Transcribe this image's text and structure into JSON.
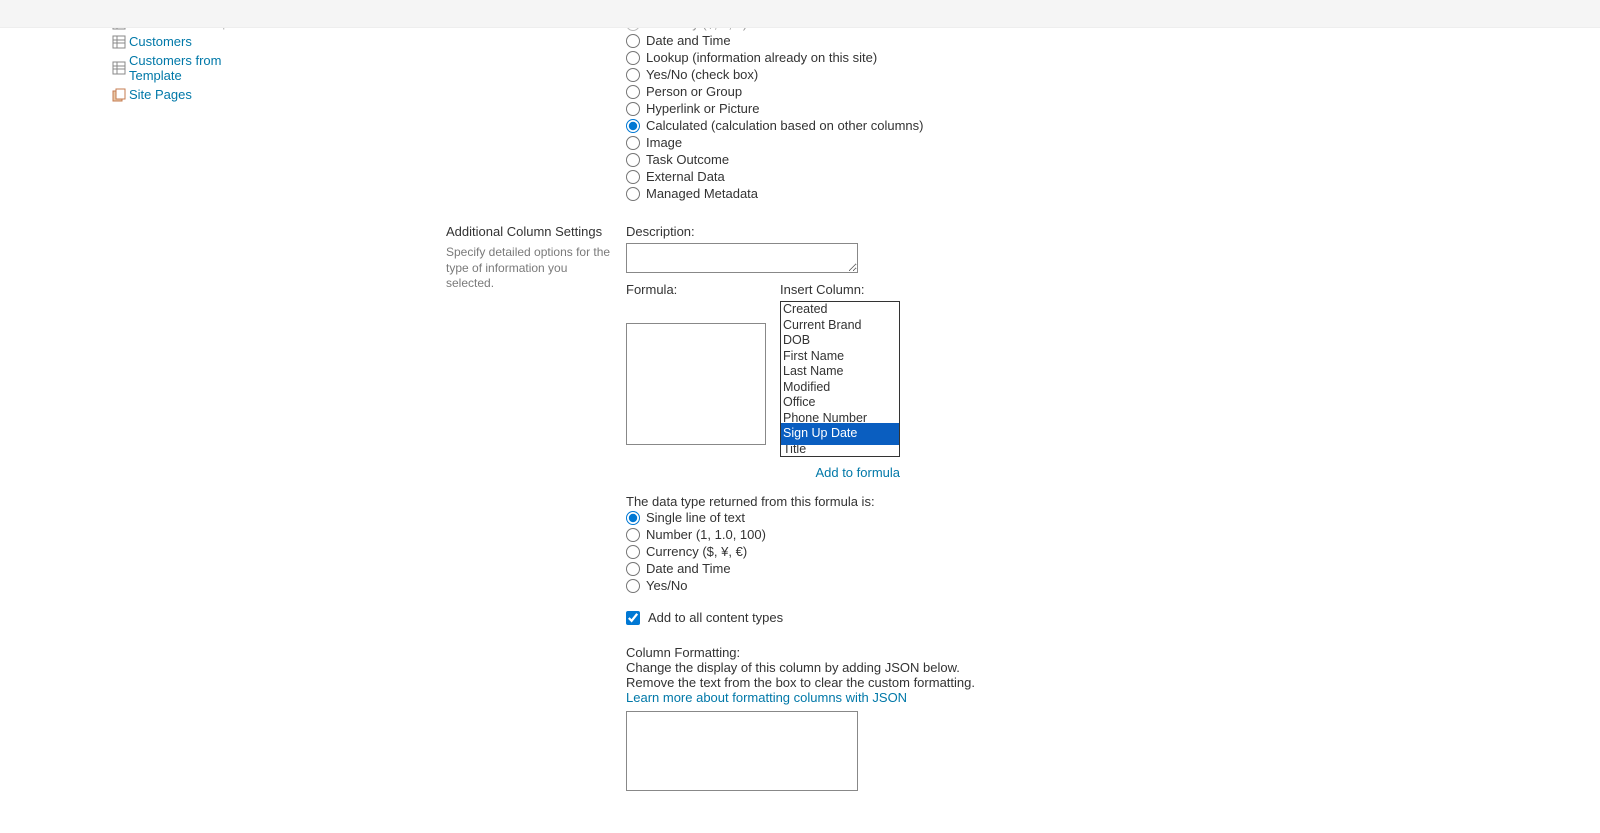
{
  "sidebar": {
    "items": [
      {
        "label": "Blank List Example",
        "type": "list",
        "cut": true
      },
      {
        "label": "Customers",
        "type": "list",
        "cut": false
      },
      {
        "label": "Customers from Template",
        "type": "list",
        "cut": false
      },
      {
        "label": "Site Pages",
        "type": "site",
        "cut": false
      }
    ]
  },
  "column_types": [
    {
      "label": "Currency ($, ¥, €)",
      "selected": false,
      "cut": true
    },
    {
      "label": "Date and Time",
      "selected": false,
      "cut": false
    },
    {
      "label": "Lookup (information already on this site)",
      "selected": false,
      "cut": false
    },
    {
      "label": "Yes/No (check box)",
      "selected": false,
      "cut": false
    },
    {
      "label": "Person or Group",
      "selected": false,
      "cut": false
    },
    {
      "label": "Hyperlink or Picture",
      "selected": false,
      "cut": false
    },
    {
      "label": "Calculated (calculation based on other columns)",
      "selected": true,
      "cut": false
    },
    {
      "label": "Image",
      "selected": false,
      "cut": false
    },
    {
      "label": "Task Outcome",
      "selected": false,
      "cut": false
    },
    {
      "label": "External Data",
      "selected": false,
      "cut": false
    },
    {
      "label": "Managed Metadata",
      "selected": false,
      "cut": false
    }
  ],
  "settings": {
    "section_title": "Additional Column Settings",
    "section_desc": "Specify detailed options for the type of information you selected.",
    "description_label": "Description:",
    "description_value": "",
    "formula_label": "Formula:",
    "formula_value": "",
    "insert_column_label": "Insert Column:",
    "add_to_formula": "Add to formula",
    "returned_label": "The data type returned from this formula is:",
    "add_to_content_types_label": "Add to all content types",
    "add_to_content_types_checked": true,
    "column_formatting_label": "Column Formatting:",
    "column_formatting_desc1": "Change the display of this column by adding JSON below.",
    "column_formatting_desc2": "Remove the text from the box to clear the custom formatting.",
    "column_formatting_link": "Learn more about formatting columns with JSON",
    "json_value": ""
  },
  "insert_columns": [
    {
      "label": "Created",
      "selected": false
    },
    {
      "label": "Current Brand",
      "selected": false
    },
    {
      "label": "DOB",
      "selected": false
    },
    {
      "label": "First Name",
      "selected": false
    },
    {
      "label": "Last Name",
      "selected": false
    },
    {
      "label": "Modified",
      "selected": false
    },
    {
      "label": "Office",
      "selected": false
    },
    {
      "label": "Phone Number",
      "selected": false
    },
    {
      "label": "Sign Up Date",
      "selected": true
    },
    {
      "label": "Title",
      "selected": false
    }
  ],
  "return_types": [
    {
      "label": "Single line of text",
      "selected": true
    },
    {
      "label": "Number (1, 1.0, 100)",
      "selected": false
    },
    {
      "label": "Currency ($, ¥, €)",
      "selected": false
    },
    {
      "label": "Date and Time",
      "selected": false
    },
    {
      "label": "Yes/No",
      "selected": false
    }
  ]
}
